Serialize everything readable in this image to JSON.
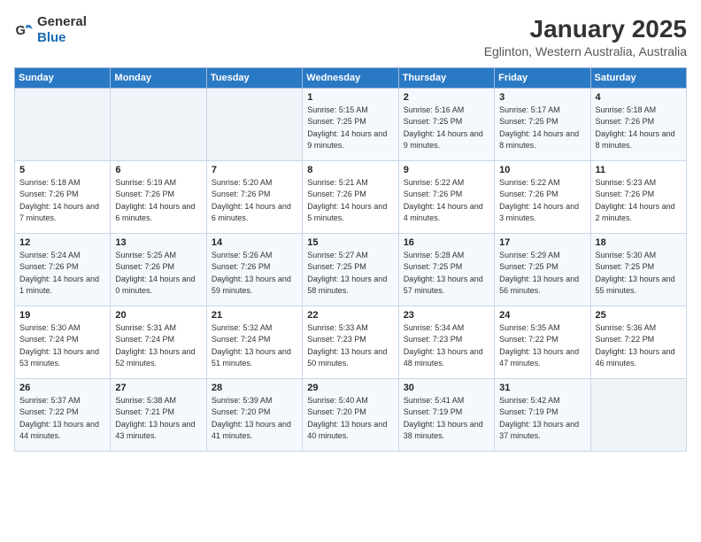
{
  "header": {
    "logo_general": "General",
    "logo_blue": "Blue",
    "title": "January 2025",
    "subtitle": "Eglinton, Western Australia, Australia"
  },
  "days_of_week": [
    "Sunday",
    "Monday",
    "Tuesday",
    "Wednesday",
    "Thursday",
    "Friday",
    "Saturday"
  ],
  "weeks": [
    [
      {
        "day": "",
        "sunrise": "",
        "sunset": "",
        "daylight": "",
        "empty": true
      },
      {
        "day": "",
        "sunrise": "",
        "sunset": "",
        "daylight": "",
        "empty": true
      },
      {
        "day": "",
        "sunrise": "",
        "sunset": "",
        "daylight": "",
        "empty": true
      },
      {
        "day": "1",
        "sunrise": "Sunrise: 5:15 AM",
        "sunset": "Sunset: 7:25 PM",
        "daylight": "Daylight: 14 hours and 9 minutes."
      },
      {
        "day": "2",
        "sunrise": "Sunrise: 5:16 AM",
        "sunset": "Sunset: 7:25 PM",
        "daylight": "Daylight: 14 hours and 9 minutes."
      },
      {
        "day": "3",
        "sunrise": "Sunrise: 5:17 AM",
        "sunset": "Sunset: 7:25 PM",
        "daylight": "Daylight: 14 hours and 8 minutes."
      },
      {
        "day": "4",
        "sunrise": "Sunrise: 5:18 AM",
        "sunset": "Sunset: 7:26 PM",
        "daylight": "Daylight: 14 hours and 8 minutes."
      }
    ],
    [
      {
        "day": "5",
        "sunrise": "Sunrise: 5:18 AM",
        "sunset": "Sunset: 7:26 PM",
        "daylight": "Daylight: 14 hours and 7 minutes."
      },
      {
        "day": "6",
        "sunrise": "Sunrise: 5:19 AM",
        "sunset": "Sunset: 7:26 PM",
        "daylight": "Daylight: 14 hours and 6 minutes."
      },
      {
        "day": "7",
        "sunrise": "Sunrise: 5:20 AM",
        "sunset": "Sunset: 7:26 PM",
        "daylight": "Daylight: 14 hours and 6 minutes."
      },
      {
        "day": "8",
        "sunrise": "Sunrise: 5:21 AM",
        "sunset": "Sunset: 7:26 PM",
        "daylight": "Daylight: 14 hours and 5 minutes."
      },
      {
        "day": "9",
        "sunrise": "Sunrise: 5:22 AM",
        "sunset": "Sunset: 7:26 PM",
        "daylight": "Daylight: 14 hours and 4 minutes."
      },
      {
        "day": "10",
        "sunrise": "Sunrise: 5:22 AM",
        "sunset": "Sunset: 7:26 PM",
        "daylight": "Daylight: 14 hours and 3 minutes."
      },
      {
        "day": "11",
        "sunrise": "Sunrise: 5:23 AM",
        "sunset": "Sunset: 7:26 PM",
        "daylight": "Daylight: 14 hours and 2 minutes."
      }
    ],
    [
      {
        "day": "12",
        "sunrise": "Sunrise: 5:24 AM",
        "sunset": "Sunset: 7:26 PM",
        "daylight": "Daylight: 14 hours and 1 minute."
      },
      {
        "day": "13",
        "sunrise": "Sunrise: 5:25 AM",
        "sunset": "Sunset: 7:26 PM",
        "daylight": "Daylight: 14 hours and 0 minutes."
      },
      {
        "day": "14",
        "sunrise": "Sunrise: 5:26 AM",
        "sunset": "Sunset: 7:26 PM",
        "daylight": "Daylight: 13 hours and 59 minutes."
      },
      {
        "day": "15",
        "sunrise": "Sunrise: 5:27 AM",
        "sunset": "Sunset: 7:25 PM",
        "daylight": "Daylight: 13 hours and 58 minutes."
      },
      {
        "day": "16",
        "sunrise": "Sunrise: 5:28 AM",
        "sunset": "Sunset: 7:25 PM",
        "daylight": "Daylight: 13 hours and 57 minutes."
      },
      {
        "day": "17",
        "sunrise": "Sunrise: 5:29 AM",
        "sunset": "Sunset: 7:25 PM",
        "daylight": "Daylight: 13 hours and 56 minutes."
      },
      {
        "day": "18",
        "sunrise": "Sunrise: 5:30 AM",
        "sunset": "Sunset: 7:25 PM",
        "daylight": "Daylight: 13 hours and 55 minutes."
      }
    ],
    [
      {
        "day": "19",
        "sunrise": "Sunrise: 5:30 AM",
        "sunset": "Sunset: 7:24 PM",
        "daylight": "Daylight: 13 hours and 53 minutes."
      },
      {
        "day": "20",
        "sunrise": "Sunrise: 5:31 AM",
        "sunset": "Sunset: 7:24 PM",
        "daylight": "Daylight: 13 hours and 52 minutes."
      },
      {
        "day": "21",
        "sunrise": "Sunrise: 5:32 AM",
        "sunset": "Sunset: 7:24 PM",
        "daylight": "Daylight: 13 hours and 51 minutes."
      },
      {
        "day": "22",
        "sunrise": "Sunrise: 5:33 AM",
        "sunset": "Sunset: 7:23 PM",
        "daylight": "Daylight: 13 hours and 50 minutes."
      },
      {
        "day": "23",
        "sunrise": "Sunrise: 5:34 AM",
        "sunset": "Sunset: 7:23 PM",
        "daylight": "Daylight: 13 hours and 48 minutes."
      },
      {
        "day": "24",
        "sunrise": "Sunrise: 5:35 AM",
        "sunset": "Sunset: 7:22 PM",
        "daylight": "Daylight: 13 hours and 47 minutes."
      },
      {
        "day": "25",
        "sunrise": "Sunrise: 5:36 AM",
        "sunset": "Sunset: 7:22 PM",
        "daylight": "Daylight: 13 hours and 46 minutes."
      }
    ],
    [
      {
        "day": "26",
        "sunrise": "Sunrise: 5:37 AM",
        "sunset": "Sunset: 7:22 PM",
        "daylight": "Daylight: 13 hours and 44 minutes."
      },
      {
        "day": "27",
        "sunrise": "Sunrise: 5:38 AM",
        "sunset": "Sunset: 7:21 PM",
        "daylight": "Daylight: 13 hours and 43 minutes."
      },
      {
        "day": "28",
        "sunrise": "Sunrise: 5:39 AM",
        "sunset": "Sunset: 7:20 PM",
        "daylight": "Daylight: 13 hours and 41 minutes."
      },
      {
        "day": "29",
        "sunrise": "Sunrise: 5:40 AM",
        "sunset": "Sunset: 7:20 PM",
        "daylight": "Daylight: 13 hours and 40 minutes."
      },
      {
        "day": "30",
        "sunrise": "Sunrise: 5:41 AM",
        "sunset": "Sunset: 7:19 PM",
        "daylight": "Daylight: 13 hours and 38 minutes."
      },
      {
        "day": "31",
        "sunrise": "Sunrise: 5:42 AM",
        "sunset": "Sunset: 7:19 PM",
        "daylight": "Daylight: 13 hours and 37 minutes."
      },
      {
        "day": "",
        "sunrise": "",
        "sunset": "",
        "daylight": "",
        "empty": true
      }
    ]
  ]
}
